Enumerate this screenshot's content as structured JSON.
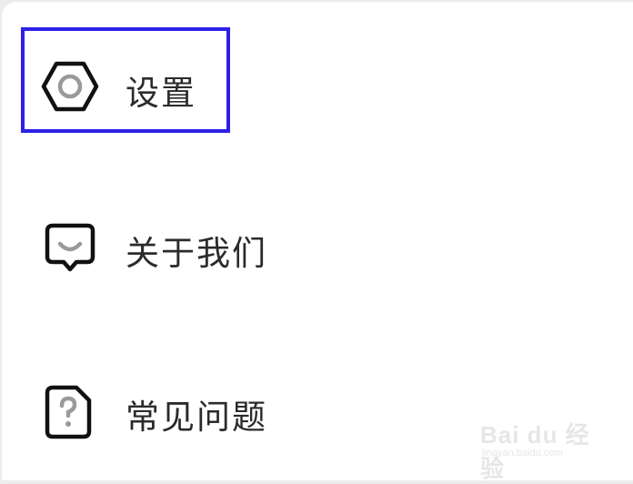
{
  "menu": {
    "items": [
      {
        "label": "设置",
        "icon": "settings-hexagon-icon"
      },
      {
        "label": "关于我们",
        "icon": "chat-bubble-smile-icon"
      },
      {
        "label": "常见问题",
        "icon": "question-document-icon"
      }
    ]
  },
  "highlight": {
    "target": "设置",
    "color": "#2b21e6"
  },
  "watermark": {
    "brand": "Bai du 经验",
    "url": "jingyan.baidu.com"
  },
  "colors": {
    "text": "#2b2b2b",
    "icon_stroke": "#111111",
    "icon_accent": "#9a9a9a",
    "background": "#ffffff"
  }
}
